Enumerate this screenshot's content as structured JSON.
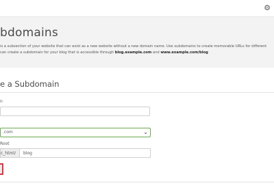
{
  "toolbar": {
    "icon": "user-settings-icon"
  },
  "header": {
    "title": "bdomains",
    "desc_line1": "is a subsection of your website that can exist as a new website without a new domain name. Use subdomains to create memorable URLs for different",
    "desc_line2_pre": "can create a subdomain for your blog that is accessible through ",
    "desc_line2_b1": "blog.example.com",
    "desc_line2_mid": " and ",
    "desc_line2_b2": "www.example.com/blog"
  },
  "form": {
    "section_title": "e a Subdomain",
    "subdomain_label": "n",
    "subdomain_value": "",
    "domain_label": "",
    "domain_selected": ".com",
    "docroot_label": "Root",
    "docroot_prefix": "c_html/",
    "docroot_value": "blog",
    "create_label": ""
  },
  "colors": {
    "accent_border": "#6aa84f",
    "highlight": "#d9363e"
  }
}
